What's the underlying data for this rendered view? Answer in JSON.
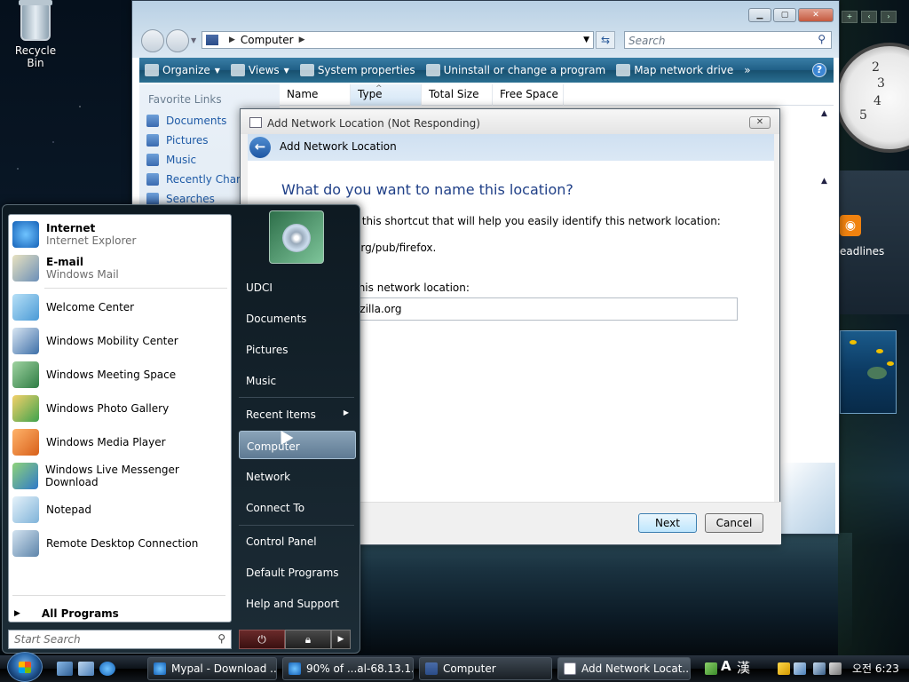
{
  "desktop": {
    "recycle_bin_label": "Recycle Bin"
  },
  "explorer": {
    "address_path": "Computer",
    "search_placeholder": "Search",
    "toolbar": {
      "organize": "Organize",
      "views": "Views",
      "system_properties": "System properties",
      "uninstall": "Uninstall or change a program",
      "map_drive": "Map network drive",
      "more": "»"
    },
    "favorite_links_title": "Favorite Links",
    "favorite_links": [
      "Documents",
      "Pictures",
      "Music",
      "Recently Chang",
      "Searches"
    ],
    "columns": [
      "Name",
      "Type",
      "Total Size",
      "Free Space"
    ]
  },
  "dialog": {
    "window_title": "Add Network Location (Not Responding)",
    "wizard_title": "Add Network Location",
    "heading": "What do you want to name this location?",
    "instruction": "r this shortcut that will help you easily identify this network location:",
    "address_line": "org/pub/firefox.",
    "field_label": "this network location:",
    "field_value": "ozilla.org",
    "next_label": "Next",
    "cancel_label": "Cancel",
    "close_glyph": "✕"
  },
  "start_menu": {
    "pinned": [
      {
        "name": "Internet",
        "sub": "Internet Explorer"
      },
      {
        "name": "E-mail",
        "sub": "Windows Mail"
      }
    ],
    "recent": [
      "Welcome Center",
      "Windows Mobility Center",
      "Windows Meeting Space",
      "Windows Photo Gallery",
      "Windows Media Player",
      "Windows Live Messenger Download",
      "Notepad",
      "Remote Desktop Connection"
    ],
    "all_programs": "All Programs",
    "search_placeholder": "Start Search",
    "right_items": {
      "user": "UDCI",
      "documents": "Documents",
      "pictures": "Pictures",
      "music": "Music",
      "recent_items": "Recent Items",
      "computer": "Computer",
      "network": "Network",
      "connect_to": "Connect To",
      "control_panel": "Control Panel",
      "default_programs": "Default Programs",
      "help_support": "Help and Support"
    }
  },
  "gadgets": {
    "headlines_label": "eadlines",
    "clock_numbers": [
      "2",
      "3",
      "4",
      "5"
    ]
  },
  "taskbar": {
    "buttons": [
      "Mypal - Download ...",
      "90% of ...al-68.13.1....",
      "Computer",
      "Add Network Locat..."
    ],
    "ime_a": "A",
    "ime_han": "漢",
    "clock": "오전 6:23"
  },
  "colors": {
    "link_blue": "#1e5aa6",
    "heading_blue": "#1f3f87",
    "command_bar": "#1f5f86",
    "start_hover": "#7892a8"
  }
}
